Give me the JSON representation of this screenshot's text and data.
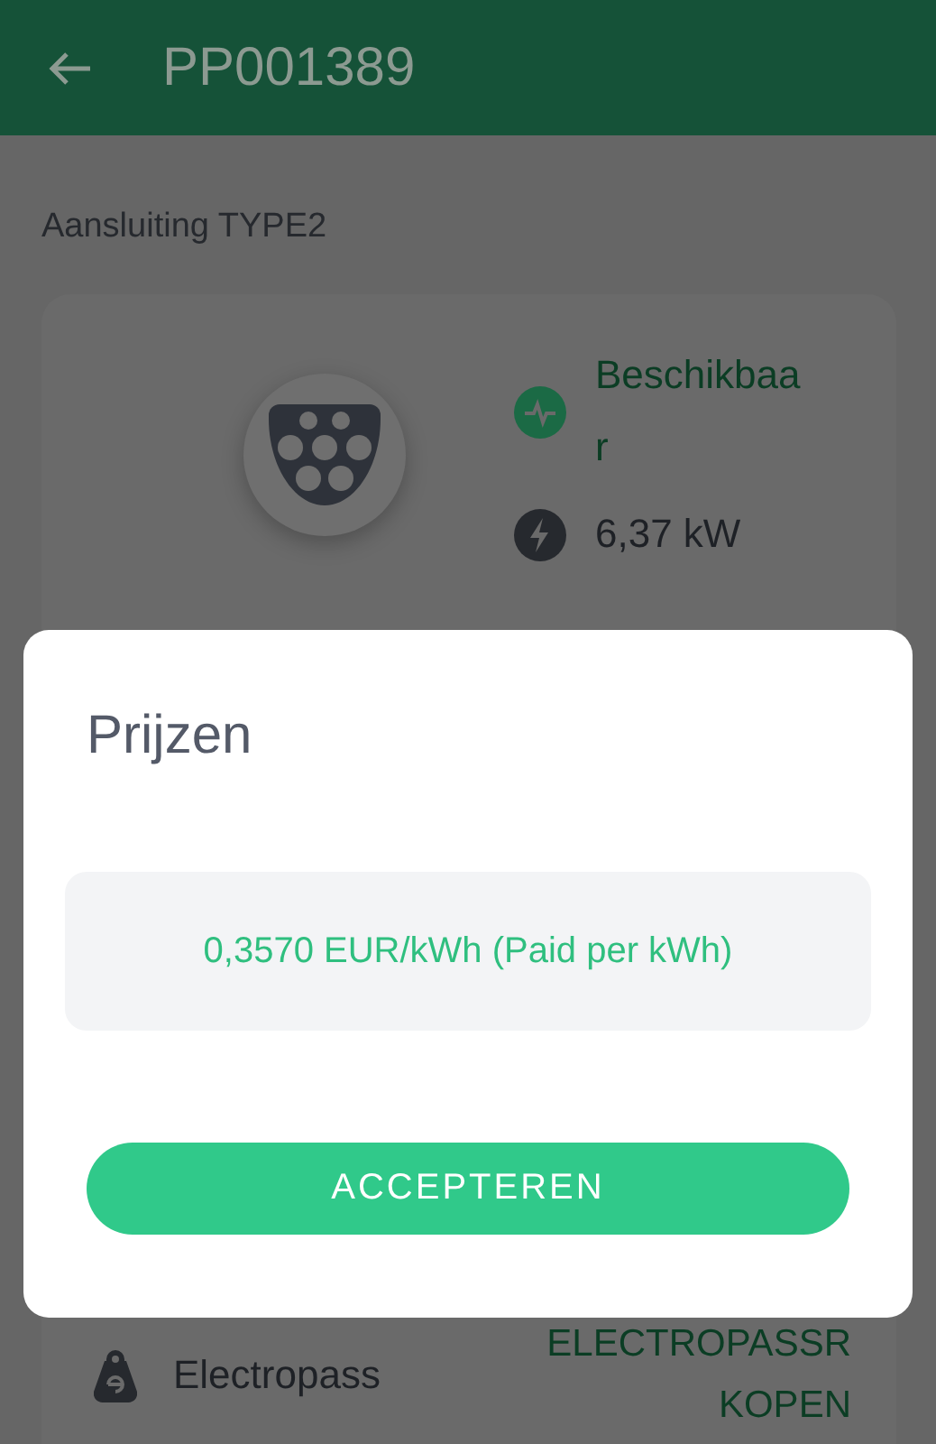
{
  "header": {
    "title": "PP001389"
  },
  "connector": {
    "title": "Aansluiting TYPE2",
    "status": "Beschikbaar",
    "power": "6,37 kW"
  },
  "payment": {
    "label": "Electropass",
    "action": "ELECTROPASSR KOPEN"
  },
  "dialog": {
    "title": "Prijzen",
    "price": "0,3570 EUR/kWh (Paid per kWh)",
    "button": "ACCEPTEREN"
  }
}
